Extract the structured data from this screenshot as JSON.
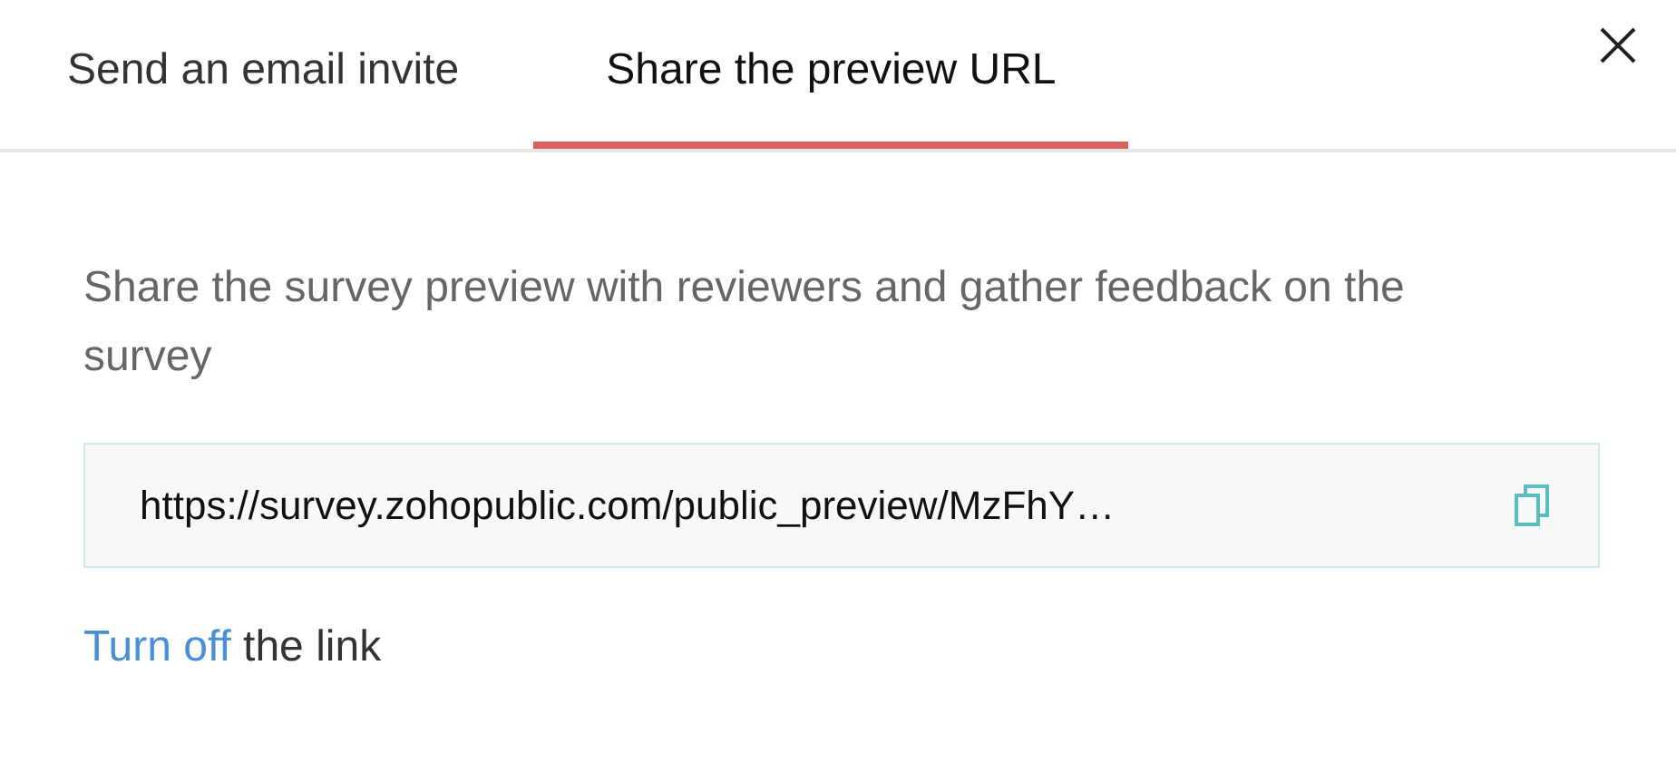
{
  "tabs": [
    {
      "label": "Send an email invite",
      "selected": false
    },
    {
      "label": "Share the preview URL",
      "selected": true
    }
  ],
  "description": "Share the survey preview with reviewers and gather feedback on the survey",
  "url_field": {
    "value": "https://survey.zohopublic.com/public_preview/MzFhY…"
  },
  "footer": {
    "link": "Turn off",
    "text": "the link"
  }
}
